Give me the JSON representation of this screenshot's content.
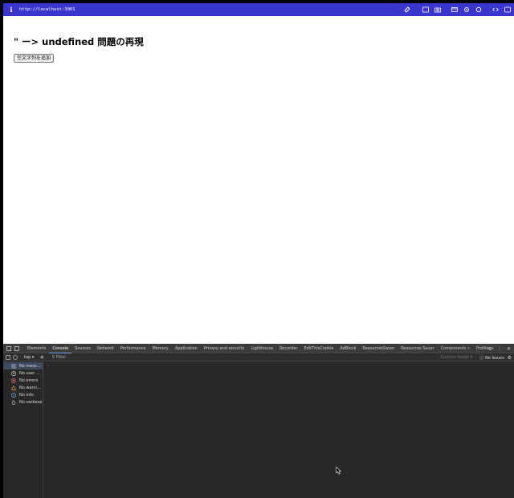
{
  "browser": {
    "url": "http://localhost:3001",
    "info_icon": "info-icon",
    "toolbar_icons": [
      "link-icon",
      "translate-icon",
      "camera-icon",
      "card-icon",
      "gear-icon",
      "extension-icon",
      "code-icon",
      "settings-icon"
    ]
  },
  "page": {
    "heading": "\" ー> undefined 問題の再現",
    "button_label": "空文字列を追加"
  },
  "devtools": {
    "tabs": [
      "Elements",
      "Console",
      "Sources",
      "Network",
      "Performance",
      "Memory",
      "Application",
      "Privacy and security",
      "Lighthouse",
      "Recorder",
      "EditThisCookie",
      "AdBlock",
      "ResourcesSaver",
      "Resources Saver",
      "Components »",
      "Profiler »"
    ],
    "active_tab": "Console",
    "toolbar": {
      "context": "top ▾",
      "filter_placeholder": "Filter",
      "levels": "Custom levels ▾",
      "issues": "No Issues"
    },
    "sidebar": [
      {
        "label": "No mess...",
        "icon": "list-icon",
        "color": "#cccccc"
      },
      {
        "label": "No user ...",
        "icon": "user-icon",
        "color": "#cccccc"
      },
      {
        "label": "No errors",
        "icon": "error-icon",
        "color": "#e46962"
      },
      {
        "label": "No warni...",
        "icon": "warning-icon",
        "color": "#e6a23c"
      },
      {
        "label": "No info",
        "icon": "info-icon",
        "color": "#7cacf8"
      },
      {
        "label": "No verbose",
        "icon": "bug-icon",
        "color": "#cccccc"
      }
    ],
    "prompt": "›"
  }
}
